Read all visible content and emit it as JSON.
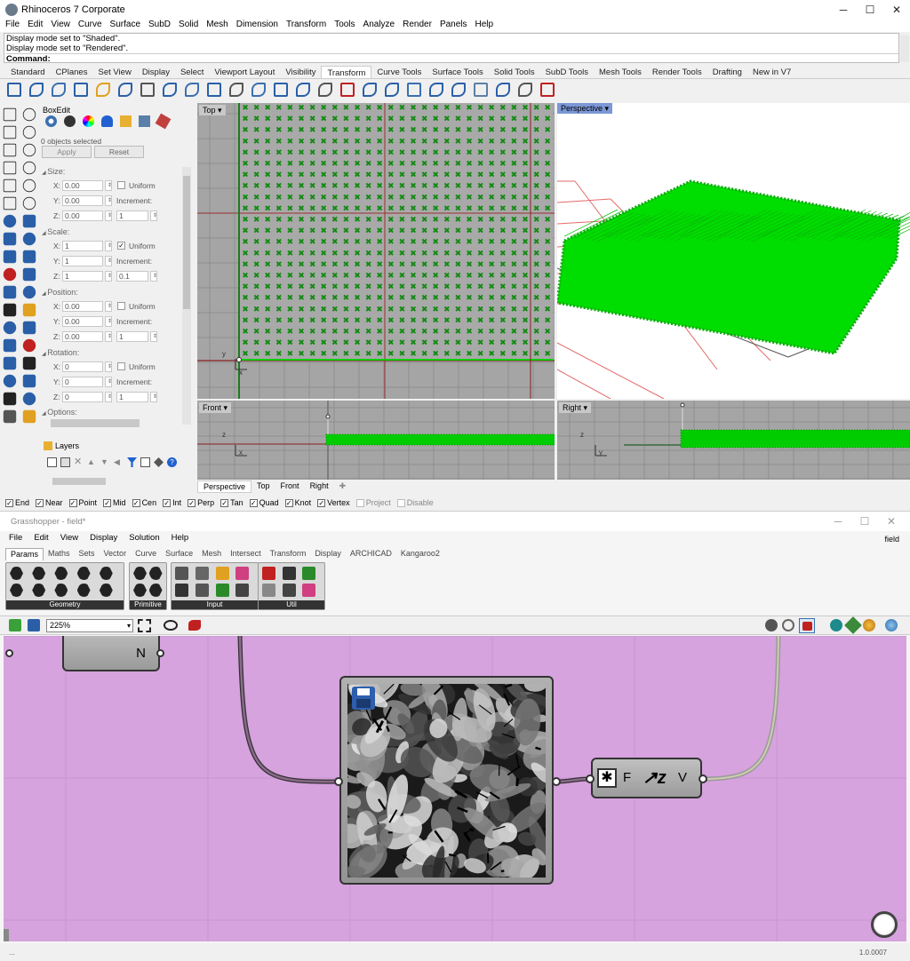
{
  "rhino": {
    "title": "Rhinoceros 7 Corporate",
    "menu": [
      "File",
      "Edit",
      "View",
      "Curve",
      "Surface",
      "SubD",
      "Solid",
      "Mesh",
      "Dimension",
      "Transform",
      "Tools",
      "Analyze",
      "Render",
      "Panels",
      "Help"
    ],
    "command_history": [
      "Display mode set to \"Shaded\".",
      "Display mode set to \"Rendered\"."
    ],
    "command_prompt": "Command:",
    "toolbar_tabs": [
      "Standard",
      "CPlanes",
      "Set View",
      "Display",
      "Select",
      "Viewport Layout",
      "Visibility",
      "Transform",
      "Curve Tools",
      "Surface Tools",
      "Solid Tools",
      "SubD Tools",
      "Mesh Tools",
      "Render Tools",
      "Drafting",
      "New in V7"
    ],
    "active_tab": "Transform",
    "panel": {
      "title": "BoxEdit",
      "selection": "0 objects selected",
      "apply": "Apply",
      "reset": "Reset",
      "sections": [
        {
          "name": "Size:",
          "x": "0.00",
          "y": "0.00",
          "z": "0.00",
          "option": "Uniform",
          "increment_label": "Increment:",
          "increment": "1",
          "checked": false
        },
        {
          "name": "Scale:",
          "x": "1",
          "y": "1",
          "z": "1",
          "option": "Uniform",
          "increment_label": "Increment:",
          "increment": "0.1",
          "checked": true
        },
        {
          "name": "Position:",
          "x": "0.00",
          "y": "0.00",
          "z": "0.00",
          "option": "Uniform",
          "increment_label": "Increment:",
          "increment": "1",
          "checked": false
        },
        {
          "name": "Rotation:",
          "x": "0",
          "y": "0",
          "z": "0",
          "option": "Uniform",
          "increment_label": "Increment:",
          "increment": "1",
          "checked": false
        }
      ],
      "options_label": "Options:",
      "layers_title": "Layers"
    },
    "viewports": {
      "top": "Top",
      "perspective": "Perspective",
      "front": "Front",
      "right": "Right"
    },
    "axis_labels": {
      "x": "x",
      "y": "y",
      "z": "z"
    },
    "viewport_tabs": [
      "Perspective",
      "Top",
      "Front",
      "Right"
    ],
    "osnaps": [
      {
        "label": "End",
        "checked": true
      },
      {
        "label": "Near",
        "checked": true
      },
      {
        "label": "Point",
        "checked": true
      },
      {
        "label": "Mid",
        "checked": true
      },
      {
        "label": "Cen",
        "checked": true
      },
      {
        "label": "Int",
        "checked": true
      },
      {
        "label": "Perp",
        "checked": true
      },
      {
        "label": "Tan",
        "checked": true
      },
      {
        "label": "Quad",
        "checked": true
      },
      {
        "label": "Knot",
        "checked": true
      },
      {
        "label": "Vertex",
        "checked": true
      },
      {
        "label": "Project",
        "checked": false
      },
      {
        "label": "Disable",
        "checked": false
      }
    ]
  },
  "grasshopper": {
    "title": "Grasshopper - field*",
    "doc_name": "field",
    "menu": [
      "File",
      "Edit",
      "View",
      "Display",
      "Solution",
      "Help"
    ],
    "tabs": [
      "Params",
      "Maths",
      "Sets",
      "Vector",
      "Curve",
      "Surface",
      "Mesh",
      "Intersect",
      "Transform",
      "Display",
      "ARCHICAD",
      "Kangaroo2"
    ],
    "active_tab": "Params",
    "groups": [
      "Geometry",
      "Primitive",
      "Input",
      "Util"
    ],
    "zoom": "225%",
    "node_n": "N",
    "node_f": "F",
    "node_v": "V",
    "version": "1.0.0007",
    "status_left": "..."
  },
  "colors": {
    "accent_green": "#00cc00",
    "canvas": "#d6a3de",
    "grid_red": "#b52020",
    "grid_green": "#2a8a2a"
  }
}
